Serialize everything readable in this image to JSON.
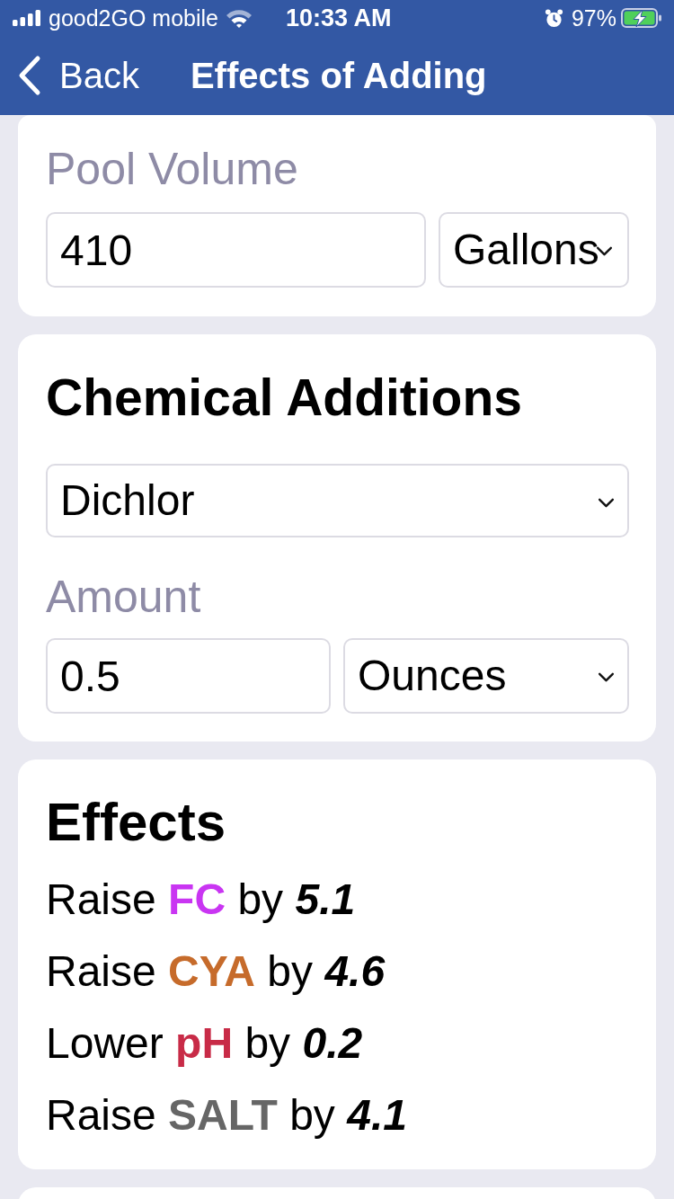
{
  "status_bar": {
    "carrier": "good2GO mobile",
    "time": "10:33 AM",
    "battery": "97%"
  },
  "nav_bar": {
    "back": "Back",
    "title": "Effects of Adding"
  },
  "pool_volume": {
    "label": "Pool Volume",
    "value": "410",
    "unit": "Gallons"
  },
  "chemical_additions": {
    "title": "Chemical Additions",
    "chemical": "Dichlor",
    "amount_label": "Amount",
    "amount": "0.5",
    "amount_unit": "Ounces"
  },
  "effects": {
    "title": "Effects",
    "items": [
      {
        "verb": "Raise",
        "parameter": "FC",
        "color": "#c935f2",
        "connector": "by",
        "amount": "5.1"
      },
      {
        "verb": "Raise",
        "parameter": "CYA",
        "color": "#c66b2b",
        "connector": "by",
        "amount": "4.6"
      },
      {
        "verb": "Lower",
        "parameter": "pH",
        "color": "#c82b47",
        "connector": "by",
        "amount": "0.2"
      },
      {
        "verb": "Raise",
        "parameter": "SALT",
        "color": "#666666",
        "connector": "by",
        "amount": "4.1"
      }
    ]
  }
}
